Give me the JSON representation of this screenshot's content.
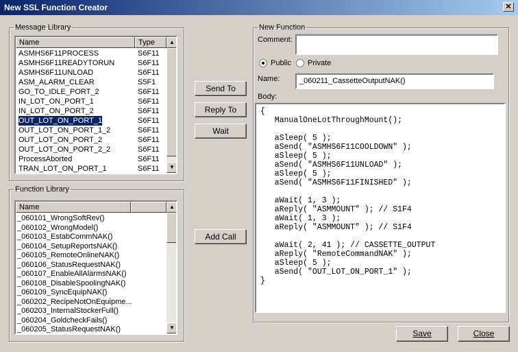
{
  "window": {
    "title": "New SSL Function Creator",
    "close_glyph": "✕"
  },
  "message_library": {
    "legend": "Message Library",
    "columns": [
      "Name",
      "Type"
    ],
    "rows": [
      {
        "name": "ASMHS6F11PROCESS",
        "type": "S6F11"
      },
      {
        "name": "ASMHS6F11READYTORUN",
        "type": "S6F11"
      },
      {
        "name": "ASMHS6F11UNLOAD",
        "type": "S6F11"
      },
      {
        "name": "ASM_ALARM_CLEAR",
        "type": "S5F1"
      },
      {
        "name": "GO_TO_IDLE_PORT_2",
        "type": "S6F11"
      },
      {
        "name": "IN_LOT_ON_PORT_1",
        "type": "S6F11"
      },
      {
        "name": "IN_LOT_ON_PORT_2",
        "type": "S6F11"
      },
      {
        "name": "OUT_LOT_ON_PORT_1",
        "type": "S6F11",
        "selected": true
      },
      {
        "name": "OUT_LOT_ON_PORT_1_2",
        "type": "S6F11"
      },
      {
        "name": "OUT_LOT_ON_PORT_2",
        "type": "S6F11"
      },
      {
        "name": "OUT_LOT_ON_PORT_2_2",
        "type": "S6F11"
      },
      {
        "name": "ProcessAborted",
        "type": "S6F11"
      },
      {
        "name": "TRAN_LOT_ON_PORT_1",
        "type": "S6F11"
      }
    ]
  },
  "function_library": {
    "legend": "Function Library",
    "columns": [
      "Name"
    ],
    "rows": [
      "_060101_WrongSoftRev()",
      "_060102_WrongModel()",
      "_060103_EstabCommNAK()",
      "_060104_SetupReportsNAK()",
      "_060105_RemoteOnlineNAK()",
      "_060106_StatusRequestNAK()",
      "_060107_EnableAllAlarmsNAK()",
      "_060108_DisableSpoolingNAK()",
      "_060109_SyncEquipNAK()",
      "_060202_RecipeNotOnEquipme...",
      "_060203_InternalStockerFull()",
      "_060204_GoldcheckFails()",
      "_060205_StatusRequestNAK()"
    ]
  },
  "buttons": {
    "send_to": "Send To",
    "reply_to": "Reply To",
    "wait": "Wait",
    "add_call": "Add Call",
    "save": "Save",
    "close": "Close"
  },
  "new_function": {
    "legend": "New Function",
    "comment_label": "Comment:",
    "comment_value": "",
    "visibility": {
      "public": "Public",
      "private": "Private",
      "selected": "Public"
    },
    "name_label": "Name:",
    "name_value": "_060211_CassetteOutputNAK()",
    "body_label": "Body:",
    "body_lines": [
      "{",
      "   ManualOneLotThroughMount();",
      "",
      "   aSleep( 5 );",
      "   aSend( \"ASMHS6F11COOLDOWN\" );",
      "   aSleep( 5 );",
      "   aSend( \"ASMHS6F11UNLOAD\" );",
      "   aSleep( 5 );",
      "   aSend( \"ASMHS6F11FINISHED\" );",
      "",
      "   aWait( 1, 3 );",
      "   aReply( \"ASMMOUNT\" ); // S1F4",
      "   aWait( 1, 3 );",
      "   aReply( \"ASMMOUNT\" ); // S1F4",
      "",
      "   aWait( 2, 41 ); // CASSETTE_OUTPUT",
      "   aReply( \"RemoteCommandNAK\" );",
      "   aSleep( 5 );",
      "   aSend( \"OUT_LOT_ON_PORT_1\" );",
      "}"
    ]
  }
}
